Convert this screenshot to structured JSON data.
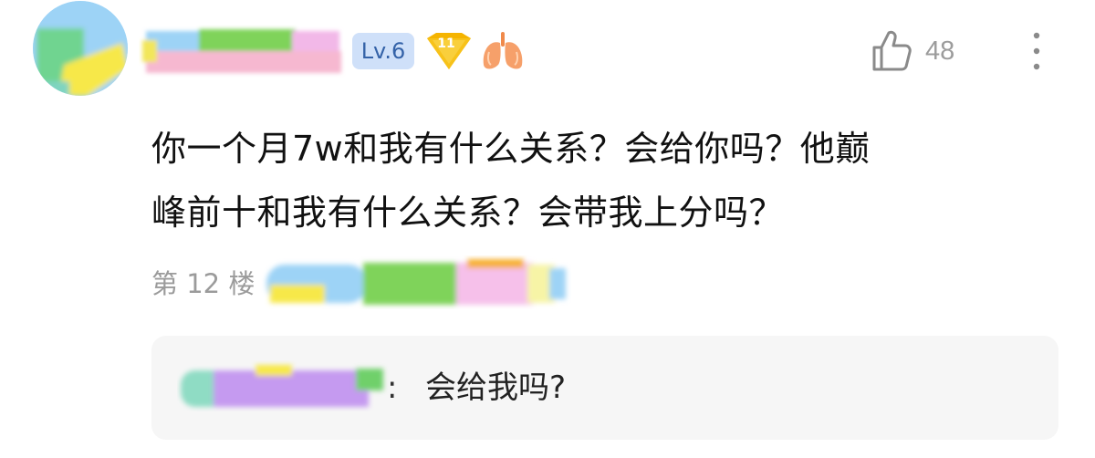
{
  "user": {
    "level": "Lv.6",
    "gem_number": "11",
    "avatar_colors": [
      "#9dd3f6",
      "#6fd490",
      "#f7e84a"
    ]
  },
  "actions": {
    "like_count": "48"
  },
  "comment": {
    "line1": "你一个月7w和我有什么关系？会给你吗？他巅",
    "line2": "峰前十和我有什么关系？会带我上分吗？",
    "floor_label": "第 12 楼"
  },
  "reply": {
    "colon": ":",
    "text": "会给我吗?"
  },
  "icons": {
    "gem": "diamond-badge-icon",
    "lung": "lung-icon",
    "like": "thumbs-up-icon",
    "more": "more-vertical-icon"
  },
  "colors": {
    "level_bg": "#cfe0f9",
    "level_text": "#3462a8",
    "gem": "#f5b400",
    "lung": "#f6a06a",
    "muted_text": "#9b9b9b",
    "reply_bg": "#f6f6f6"
  }
}
